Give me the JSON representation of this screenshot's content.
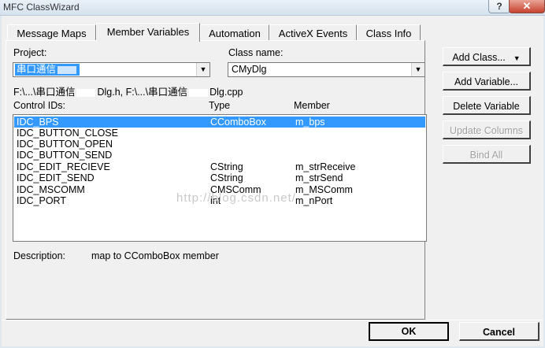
{
  "window": {
    "title": "MFC ClassWizard",
    "help_label": "?",
    "close_label": "✕"
  },
  "tabs": [
    {
      "label": "Message Maps"
    },
    {
      "label": "Member Variables"
    },
    {
      "label": "Automation"
    },
    {
      "label": "ActiveX Events"
    },
    {
      "label": "Class Info"
    }
  ],
  "project": {
    "label": "Project:",
    "value": "串口通信"
  },
  "class_name": {
    "label": "Class name:",
    "value": "CMyDlg"
  },
  "file_path": {
    "part1": "F:\\...\\串口通信",
    "part2": "Dlg.h, F:\\...\\串口通信",
    "part3": "Dlg.cpp"
  },
  "columns": {
    "ids": "Control IDs:",
    "type": "Type",
    "member": "Member"
  },
  "rows": [
    {
      "id": "IDC_BPS",
      "type": "CComboBox",
      "member": "m_bps"
    },
    {
      "id": "IDC_BUTTON_CLOSE",
      "type": "",
      "member": ""
    },
    {
      "id": "IDC_BUTTON_OPEN",
      "type": "",
      "member": ""
    },
    {
      "id": "IDC_BUTTON_SEND",
      "type": "",
      "member": ""
    },
    {
      "id": "IDC_EDIT_RECIEVE",
      "type": "CString",
      "member": "m_strReceive"
    },
    {
      "id": "IDC_EDIT_SEND",
      "type": "CString",
      "member": "m_strSend"
    },
    {
      "id": "IDC_MSCOMM",
      "type": "CMSComm",
      "member": "m_MSComm"
    },
    {
      "id": "IDC_PORT",
      "type": "int",
      "member": "m_nPort"
    }
  ],
  "watermark": "http://blog.csdn.net/",
  "description": {
    "label": "Description:",
    "value": "map to CComboBox member"
  },
  "buttons": {
    "add_class": "Add Class...",
    "add_variable": "Add Variable...",
    "delete_variable": "Delete Variable",
    "update_columns": "Update Columns",
    "bind_all": "Bind All",
    "ok": "OK",
    "cancel": "Cancel"
  },
  "colors": {
    "selection": "#3399ff",
    "close_button": "#c7422f",
    "disabled_text": "#a0a0a0"
  }
}
